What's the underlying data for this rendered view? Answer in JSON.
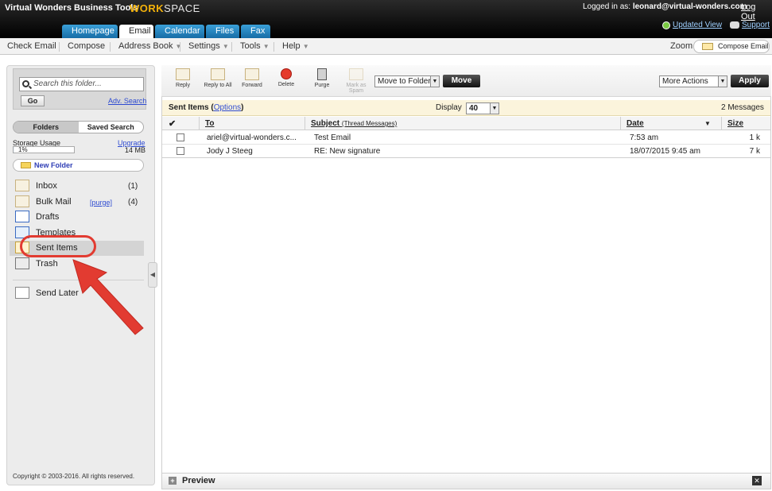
{
  "app": {
    "brand": "Virtual Wonders Business Tools",
    "workspace_part1": "WORK",
    "workspace_part2": "SPACE",
    "logged_in_label": "Logged in as:",
    "user": "leonard@virtual-wonders.com",
    "logout": "Log Out",
    "updated_view": "Updated View",
    "support": "Support"
  },
  "tabs": [
    {
      "label": "Homepage"
    },
    {
      "label": "Email"
    },
    {
      "label": "Calendar"
    },
    {
      "label": "Files"
    },
    {
      "label": "Fax"
    }
  ],
  "menu": {
    "check_email": "Check Email",
    "compose": "Compose",
    "address_book": "Address Book",
    "settings": "Settings",
    "tools": "Tools",
    "help": "Help",
    "zoom": "Zoom",
    "compose_email": "Compose Email"
  },
  "sidebar": {
    "search_placeholder": "Search this folder...",
    "go": "Go",
    "adv_search": "Adv. Search",
    "toggle_folders": "Folders",
    "toggle_saved_search": "Saved Search",
    "storage_label": "Storage Usage",
    "upgrade": "Upgrade",
    "storage_percent": "1%",
    "storage_fraction": 0.01,
    "storage_size": "14 MB",
    "new_folder": "New Folder",
    "purge": "[purge]",
    "folders": [
      {
        "label": "Inbox",
        "count": "(1)"
      },
      {
        "label": "Bulk Mail",
        "count": "(4)"
      },
      {
        "label": "Drafts",
        "count": ""
      },
      {
        "label": "Templates",
        "count": ""
      },
      {
        "label": "Sent Items",
        "count": ""
      },
      {
        "label": "Trash",
        "count": ""
      },
      {
        "label": "Send Later",
        "count": ""
      }
    ],
    "copyright": "Copyright © 2003-2016. All rights reserved."
  },
  "toolbar": {
    "reply": "Reply",
    "reply_all": "Reply to All",
    "forward": "Forward",
    "delete": "Delete",
    "purge": "Purge",
    "mark_spam_1": "Mark as",
    "mark_spam_2": "Spam",
    "move_to_folder": "Move to Folder",
    "move": "Move",
    "more_actions": "More Actions",
    "apply": "Apply"
  },
  "folder_view": {
    "title": "Sent Items",
    "options": "Options",
    "display_label": "Display",
    "display_value": "40",
    "message_count": "2 Messages"
  },
  "table": {
    "headers": {
      "to": "To",
      "subject": "Subject",
      "thread": "(Thread Messages)",
      "date": "Date",
      "size": "Size"
    },
    "rows": [
      {
        "to": "ariel@virtual-wonders.c...",
        "subject": "Test Email",
        "date": "7:53 am",
        "size": "1 k"
      },
      {
        "to": "Jody J Steeg",
        "subject": "RE: New signature",
        "date": "18/07/2015 9:45 am",
        "size": "7 k"
      }
    ]
  },
  "preview": {
    "label": "Preview"
  },
  "colors": {
    "tab_blue": "#2a8bc8",
    "highlight_red": "#e23b31",
    "workspace_gold": "#f4b20a"
  }
}
